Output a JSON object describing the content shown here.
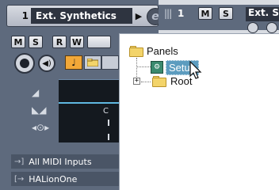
{
  "track": {
    "number": "1",
    "name": "Ext. Synthetics",
    "arrow": "▶",
    "edit_label": "e"
  },
  "buttons": {
    "mute": "M",
    "solo": "S",
    "read": "R",
    "write": "W"
  },
  "meter": {
    "note_label": "C"
  },
  "routing": {
    "input": "All MIDI Inputs",
    "output": "HALionOne"
  },
  "top_strip": {
    "number": "1",
    "mute": "M",
    "solo": "S",
    "name": "Ext. Sy"
  },
  "tree": {
    "root_label": "Panels",
    "items": [
      {
        "label": "Setup",
        "selected": true
      },
      {
        "label": "Root",
        "selected": false
      }
    ],
    "expander": "+"
  },
  "colors": {
    "accent": "#5c9cbf",
    "note_button": "#f2a838",
    "meter_line": "#5fb8e0"
  }
}
